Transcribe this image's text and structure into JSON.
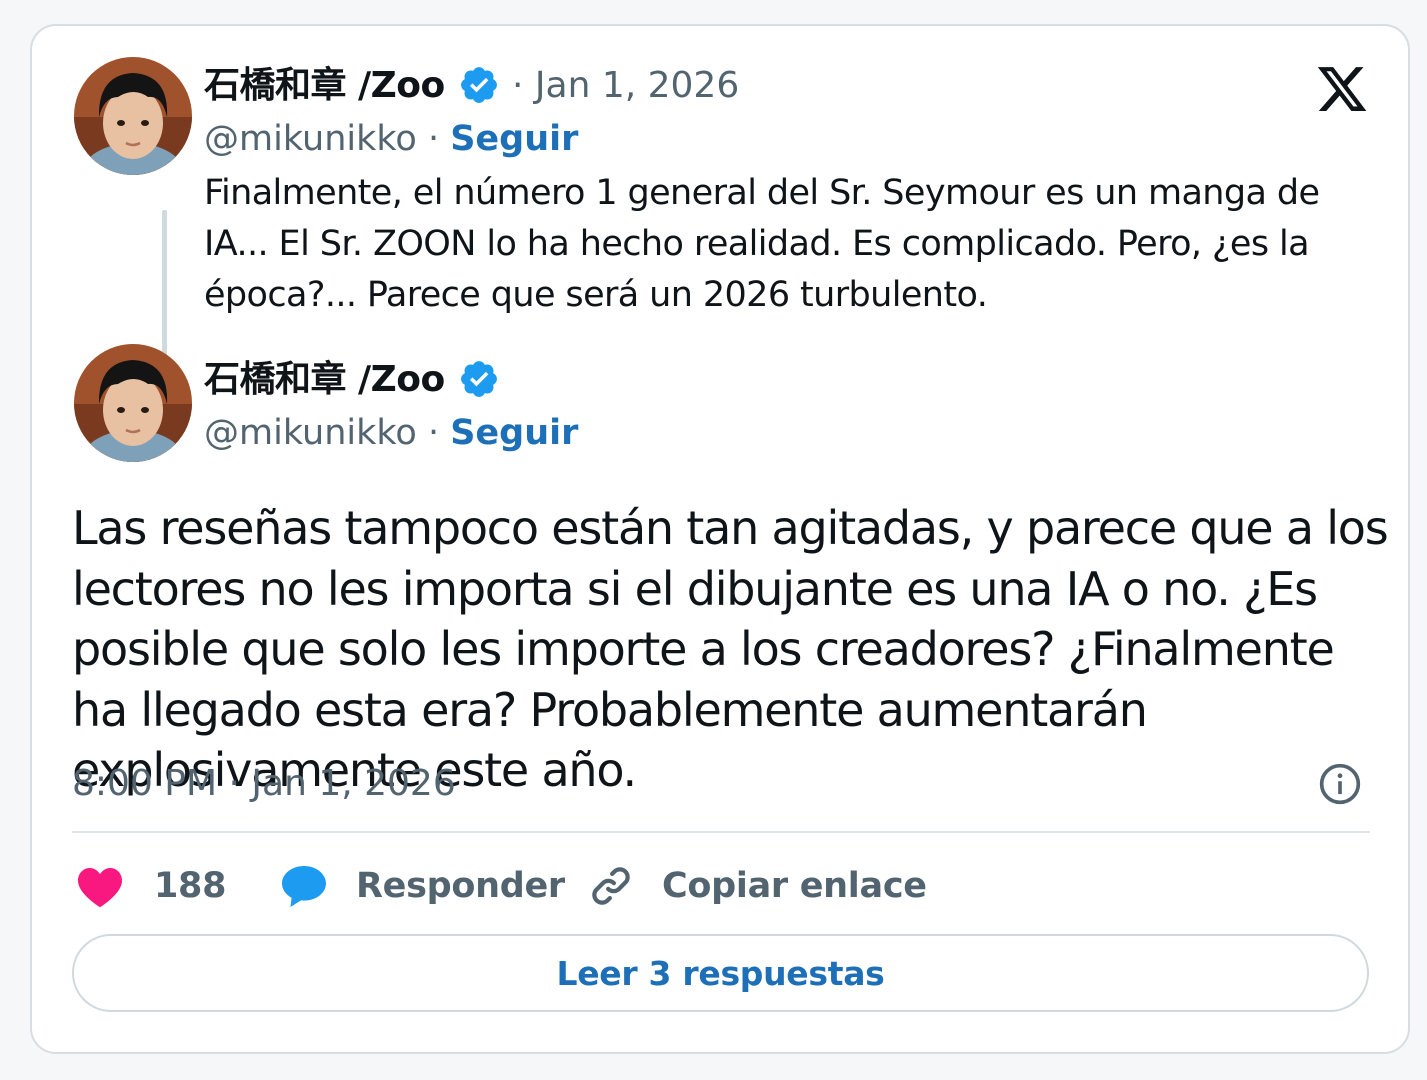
{
  "tweet_parent": {
    "author_name": "石橋和章 /Zoo",
    "date": "· Jan 1, 2026",
    "handle": "@mikunikko",
    "separator": " · ",
    "follow_label": "Seguir",
    "text": "Finalmente, el número 1 general del Sr. Seymour es un manga de IA... El Sr. ZOON lo ha hecho realidad. Es complicado. Pero, ¿es la época?... Parece que será un 2026 turbulento."
  },
  "tweet_main": {
    "author_name": "石橋和章 /Zoo",
    "handle": "@mikunikko",
    "separator": " · ",
    "follow_label": "Seguir",
    "text": "Las reseñas tampoco están tan agitadas, y parece que a los lectores no les importa si el dibujante es una IA o no. ¿Es posible que solo les importe a los creadores? ¿Finalmente ha llegado esta era? Probablemente aumentarán explosivamente este año.",
    "timestamp": "8:00 PM · Jan 1, 2026"
  },
  "actions": {
    "likes_count": "188",
    "reply_label": "Responder",
    "copy_link_label": "Copiar enlace"
  },
  "read_replies_label": "Leer 3 respuestas",
  "colors": {
    "accent_link": "#1d6fb8",
    "verified": "#1d9bf0",
    "heart": "#f91880",
    "reply_bubble": "#1d9bf0",
    "muted_text": "#536471"
  },
  "icons": {
    "verified": "verified-badge-icon",
    "logo": "x-logo-icon",
    "info": "info-icon",
    "like": "heart-icon",
    "reply": "speech-bubble-icon",
    "copy": "link-icon"
  }
}
